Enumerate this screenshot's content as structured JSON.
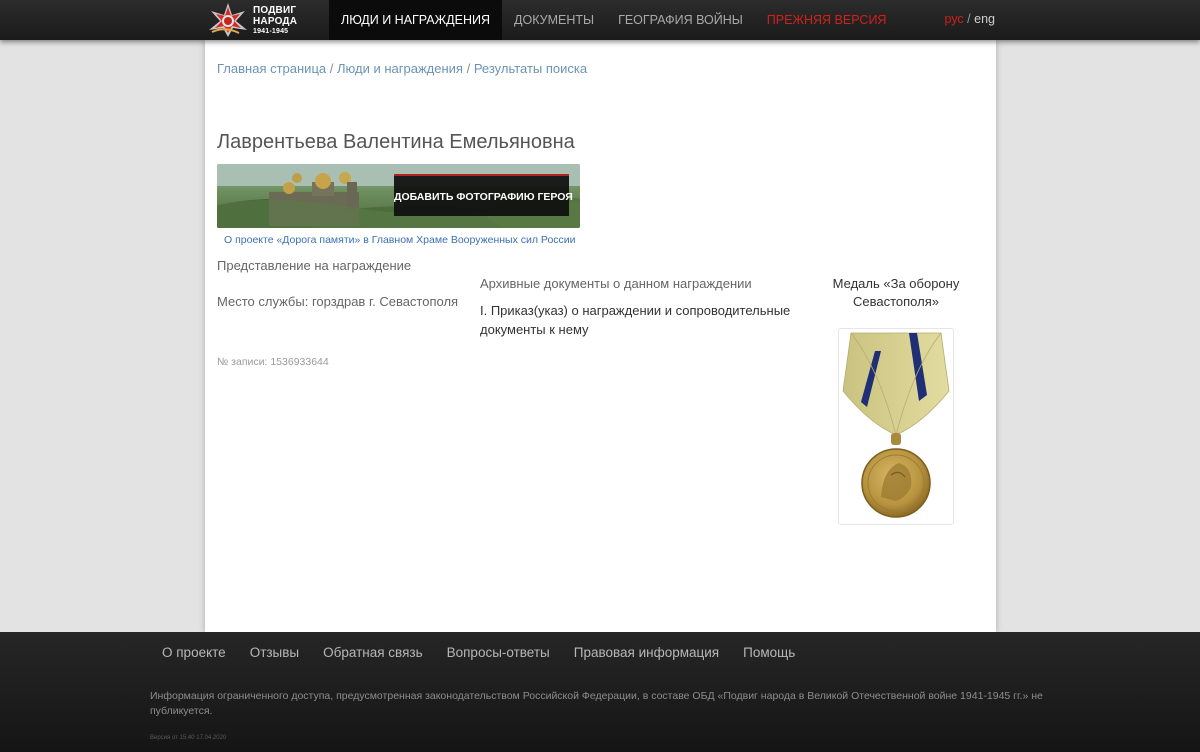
{
  "header": {
    "logo": {
      "line1": "ПОДВИГ",
      "line2": "НАРОДА",
      "years": "1941-1945"
    },
    "nav": [
      {
        "label": "Люди и награждения",
        "active": true
      },
      {
        "label": "Документы",
        "active": false
      },
      {
        "label": "География войны",
        "active": false
      },
      {
        "label": "Прежняя версия",
        "active": false
      }
    ],
    "lang": {
      "ru": "рус",
      "separator": "/",
      "en": "eng"
    }
  },
  "breadcrumbs": [
    {
      "label": "Главная страница"
    },
    {
      "label": "Люди и награждения"
    },
    {
      "label": "Результаты поиска"
    }
  ],
  "breadcrumb_separator": "/",
  "person": {
    "name": "Лаврентьева Валентина Емельяновна",
    "add_photo_button": "ДОБАВИТЬ ФОТОГРАФИЮ ГЕРОЯ",
    "about_project_link": "О проекте «Дорога памяти» в Главном Храме Вооруженных сил России",
    "award_representation": "Представление на награждение",
    "service_place": "Место службы: горздрав г. Севастополя",
    "record_number": "№ записи: 1536933644"
  },
  "archive": {
    "title": "Архивные документы о данном награждении",
    "document_link": "I. Приказ(указ) о награждении и сопроводительные документы к нему"
  },
  "medal": {
    "title": "Медаль «За оборону Севастополя»"
  },
  "footer": {
    "links": [
      "О проекте",
      "Отзывы",
      "Обратная связь",
      "Вопросы-ответы",
      "Правовая информация",
      "Помощь"
    ],
    "info": "Информация ограниченного доступа, предусмотренная законодательством Российской Федерации, в составе ОБД «Подвиг народа в Великой Отечественной войне 1941-1945 гг.» не публикуется.",
    "version": "Версия от 15:40 17.04.2020"
  },
  "colors": {
    "accent_red": "#d2201b",
    "link_blue": "#6b93b5",
    "topbar": "#1b1b1b"
  }
}
